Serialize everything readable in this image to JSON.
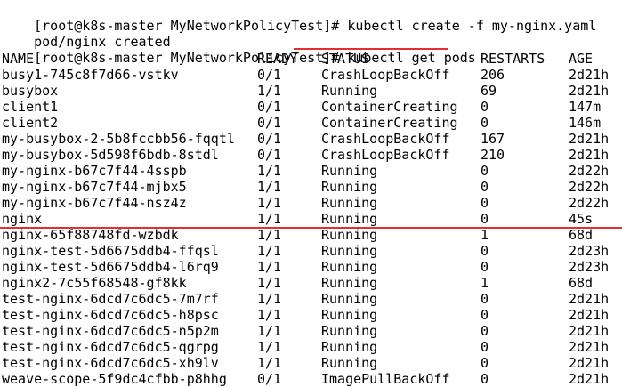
{
  "commands": [
    {
      "prompt": "[root@k8s-master MyNetworkPolicyTest]#",
      "command": "kubectl create -f my-nginx.yaml"
    },
    {
      "output": "pod/nginx created"
    },
    {
      "prompt": "[root@k8s-master MyNetworkPolicyTest]#",
      "command": "kubectl get pods"
    }
  ],
  "table": {
    "headers": {
      "name": "NAME",
      "ready": "READY",
      "status": "STATUS",
      "restarts": "RESTARTS",
      "age": "AGE"
    },
    "rows": [
      {
        "name": "busy1-745c8f7d66-vstkv",
        "ready": "0/1",
        "status": "CrashLoopBackOff",
        "restarts": "206",
        "age": "2d21h"
      },
      {
        "name": "busybox",
        "ready": "1/1",
        "status": "Running",
        "restarts": "69",
        "age": "2d21h"
      },
      {
        "name": "client1",
        "ready": "0/1",
        "status": "ContainerCreating",
        "restarts": "0",
        "age": "147m"
      },
      {
        "name": "client2",
        "ready": "0/1",
        "status": "ContainerCreating",
        "restarts": "0",
        "age": "146m"
      },
      {
        "name": "my-busybox-2-5b8fccbb56-fqqtl",
        "ready": "0/1",
        "status": "CrashLoopBackOff",
        "restarts": "167",
        "age": "2d21h"
      },
      {
        "name": "my-busybox-5d598f6bdb-8stdl",
        "ready": "0/1",
        "status": "CrashLoopBackOff",
        "restarts": "210",
        "age": "2d21h"
      },
      {
        "name": "my-nginx-b67c7f44-4sspb",
        "ready": "1/1",
        "status": "Running",
        "restarts": "0",
        "age": "2d22h"
      },
      {
        "name": "my-nginx-b67c7f44-mjbx5",
        "ready": "1/1",
        "status": "Running",
        "restarts": "0",
        "age": "2d22h"
      },
      {
        "name": "my-nginx-b67c7f44-nsz4z",
        "ready": "1/1",
        "status": "Running",
        "restarts": "0",
        "age": "2d22h"
      },
      {
        "name": "nginx",
        "ready": "1/1",
        "status": "Running",
        "restarts": "0",
        "age": "45s"
      },
      {
        "name": "nginx-65f88748fd-wzbdk",
        "ready": "1/1",
        "status": "Running",
        "restarts": "1",
        "age": "68d"
      },
      {
        "name": "nginx-test-5d6675ddb4-ffqsl",
        "ready": "1/1",
        "status": "Running",
        "restarts": "0",
        "age": "2d23h"
      },
      {
        "name": "nginx-test-5d6675ddb4-l6rq9",
        "ready": "1/1",
        "status": "Running",
        "restarts": "0",
        "age": "2d23h"
      },
      {
        "name": "nginx2-7c55f68548-gf8kk",
        "ready": "1/1",
        "status": "Running",
        "restarts": "1",
        "age": "68d"
      },
      {
        "name": "test-nginx-6dcd7c6dc5-7m7rf",
        "ready": "1/1",
        "status": "Running",
        "restarts": "0",
        "age": "2d21h"
      },
      {
        "name": "test-nginx-6dcd7c6dc5-h8psc",
        "ready": "1/1",
        "status": "Running",
        "restarts": "0",
        "age": "2d21h"
      },
      {
        "name": "test-nginx-6dcd7c6dc5-n5p2m",
        "ready": "1/1",
        "status": "Running",
        "restarts": "0",
        "age": "2d21h"
      },
      {
        "name": "test-nginx-6dcd7c6dc5-qgrpg",
        "ready": "1/1",
        "status": "Running",
        "restarts": "0",
        "age": "2d21h"
      },
      {
        "name": "test-nginx-6dcd7c6dc5-xh9lv",
        "ready": "1/1",
        "status": "Running",
        "restarts": "0",
        "age": "2d21h"
      },
      {
        "name": "weave-scope-5f9dc4cfbb-p8hhg",
        "ready": "0/1",
        "status": "ImagePullBackOff",
        "restarts": "0",
        "age": "2d21h"
      }
    ]
  },
  "annotations": {
    "highlight_color": "#e0302f",
    "underlined_command": "kubectl get pods",
    "underlined_row": "nginx"
  }
}
